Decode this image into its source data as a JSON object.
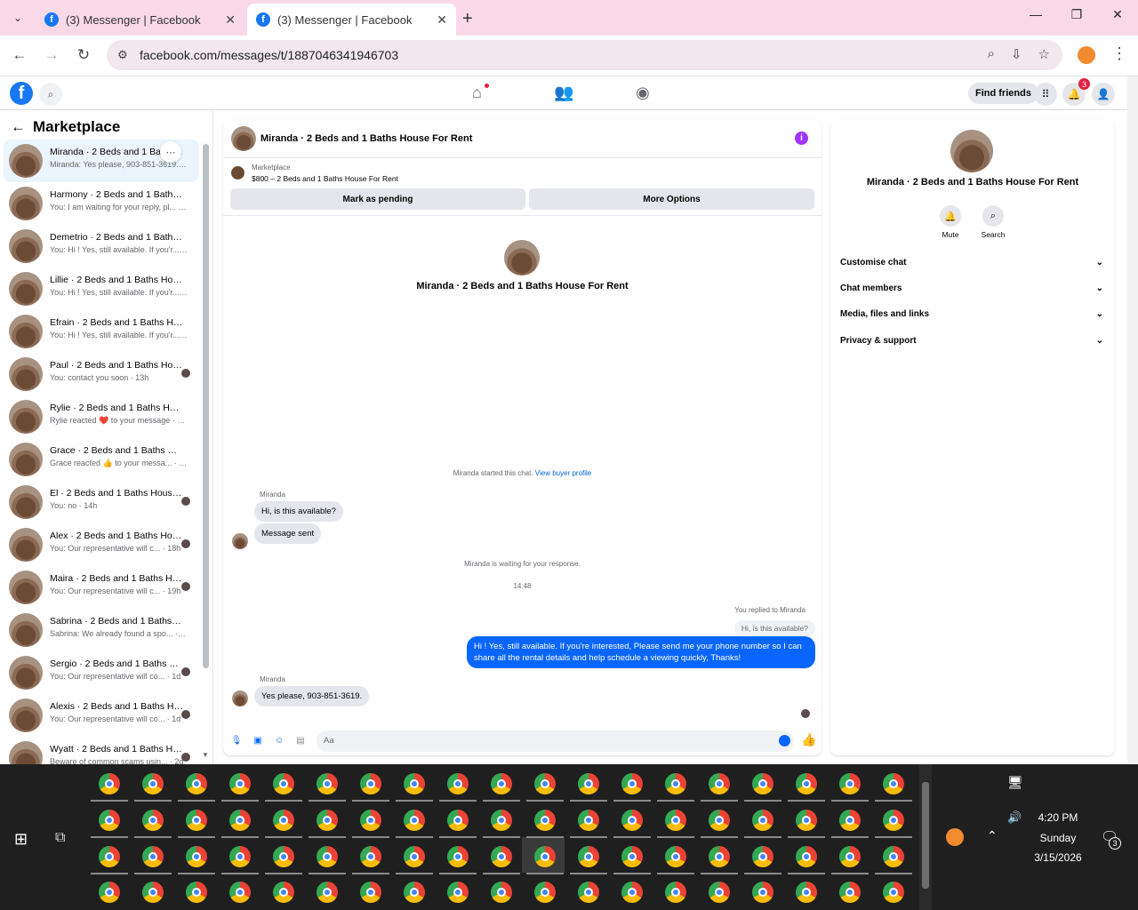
{
  "browser": {
    "tabs": [
      {
        "title": "(3) Messenger | Facebook",
        "active": false
      },
      {
        "title": "(3) Messenger | Facebook",
        "active": true
      }
    ],
    "url": "facebook.com/messages/t/1887046341946703"
  },
  "fb_header": {
    "find_friends": "Find friends",
    "notification_count": "3"
  },
  "sidebar": {
    "title": "Marketplace",
    "conversations": [
      {
        "name": "Miranda · 2 Beds and 1 Baths House For Rent",
        "snippet": "Miranda: Yes please, 903-851-3619. · 1h",
        "active": true
      },
      {
        "name": "Harmony · 2 Beds and 1 Baths House For Rent",
        "snippet": "You: I am waiting for your reply, pl... · 1h"
      },
      {
        "name": "Demetrio · 2 Beds and 1 Baths House For Rent",
        "snippet": "You: Hi ! Yes, still available. If you'r... · 1h"
      },
      {
        "name": "Lillie · 2 Beds and 1 Baths House For Rent",
        "snippet": "You: Hi ! Yes, still available. If you'r... · 1h"
      },
      {
        "name": "Efrain · 2 Beds and 1 Baths House For Rent",
        "snippet": "You: Hi ! Yes, still available. If you'r... · 1h"
      },
      {
        "name": "Paul · 2 Beds and 1 Baths House For Rent",
        "snippet": "You: contact you soon · 13h"
      },
      {
        "name": "Rylie · 2 Beds and 1 Baths House For Rent",
        "snippet": "Rylie reacted ❤️ to your message · 14h"
      },
      {
        "name": "Grace · 2 Beds and 1 Baths House For Rent",
        "snippet": "Grace reacted 👍 to your messa... · 14h"
      },
      {
        "name": "El · 2 Beds and 1 Baths House For Rent",
        "snippet": "You: no · 14h"
      },
      {
        "name": "Alex · 2 Beds and 1 Baths House For Rent",
        "snippet": "You: Our representative will c... · 18h"
      },
      {
        "name": "Maira · 2 Beds and 1 Baths House For Rent",
        "snippet": "You: Our representative will c... · 19h"
      },
      {
        "name": "Sabrina · 2 Beds and 1 Baths House For Rent",
        "snippet": "Sabrina: We already found a spo... · 19h"
      },
      {
        "name": "Sergio · 2 Beds and 1 Baths House For Rent",
        "snippet": "You: Our representative will co... · 1d"
      },
      {
        "name": "Alexis · 2 Beds and 1 Baths House For Rent",
        "snippet": "You: Our representative will co... · 1d"
      },
      {
        "name": "Wyatt · 2 Beds and 1 Baths House For Rent",
        "snippet": "Beware of common scams usin... · 2d"
      }
    ]
  },
  "chat": {
    "title": "Miranda · 2 Beds and 1 Baths House For Rent",
    "listing_label": "Marketplace",
    "listing_price": "$800 – 2 Beds and 1 Baths House For Rent",
    "mark_pending": "Mark as pending",
    "more_options": "More Options",
    "hero_name": "Miranda · 2 Beds and 1 Baths House For Rent",
    "started": "Miranda started this chat.",
    "view_profile": "View buyer profile",
    "sender": "Miranda",
    "msg1": "Hi, is this available?",
    "msg2": "Message sent",
    "waiting": "Miranda is waiting for your response.",
    "time": "14:48",
    "replied": "You replied to Miranda",
    "quoted": "Hi, is this available?",
    "outgoing": "Hi ! Yes, still available. If you're interested, Please send me your phone number so I can share all the rental details and help schedule a viewing quickly, Thanks!",
    "sender2": "Miranda",
    "msg3": "Yes please, 903-851-3619.",
    "composer_placeholder": "Aa"
  },
  "info_panel": {
    "name": "Miranda · 2 Beds and 1 Baths House For Rent",
    "mute": "Mute",
    "search": "Search",
    "sections": [
      "Customise chat",
      "Chat members",
      "Media, files and links",
      "Privacy & support"
    ]
  },
  "taskbar": {
    "time": "4:20 PM",
    "day": "Sunday",
    "date": "3/15/2026",
    "notifications": "3"
  }
}
